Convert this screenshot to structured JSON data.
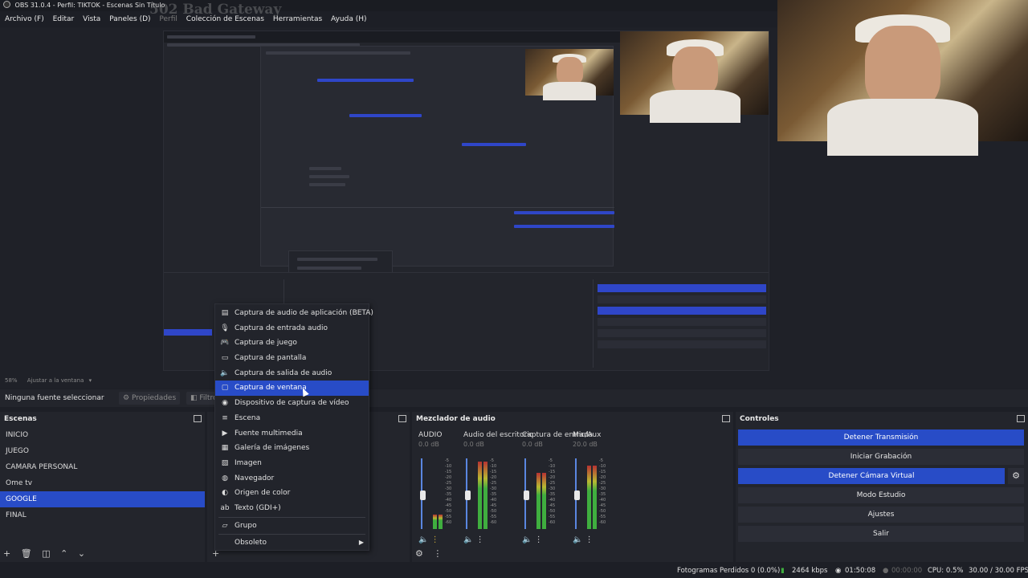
{
  "window": {
    "title": "OBS 31.0.4 - Perfil: TIKTOK - Escenas Sin Título"
  },
  "menu": [
    "Archivo (F)",
    "Editar",
    "Vista",
    "Paneles (D)",
    "Perfil",
    "Colección de Escenas",
    "Herramientas",
    "Ayuda (H)"
  ],
  "overlay_text": "502 Bad Gateway",
  "preview": {
    "zoom_label": "58%",
    "fit_label": "Ajustar a la ventana"
  },
  "sources_toolbar": {
    "no_source": "Ninguna fuente seleccionar",
    "properties": "Propiedades",
    "filters": "Filtros"
  },
  "scenes": {
    "title": "Escenas",
    "items": [
      "INICIO",
      "JUEGO",
      "CAMARA PERSONAL",
      "Ome tv",
      "GOOGLE",
      "FINAL"
    ],
    "active_index": 4
  },
  "context_menu": {
    "items": [
      {
        "label": "Captura de audio de aplicación (BETA)",
        "icon": "app-audio-icon"
      },
      {
        "label": "Captura de entrada audio",
        "icon": "microphone-icon"
      },
      {
        "label": "Captura de juego",
        "icon": "gamepad-icon"
      },
      {
        "label": "Captura de pantalla",
        "icon": "monitor-icon"
      },
      {
        "label": "Captura de salida de audio",
        "icon": "speaker-icon"
      },
      {
        "label": "Captura de ventana",
        "icon": "window-icon",
        "selected": true
      },
      {
        "label": "Dispositivo de captura de vídeo",
        "icon": "camera-icon"
      },
      {
        "label": "Escena",
        "icon": "list-icon"
      },
      {
        "label": "Fuente multimedia",
        "icon": "play-icon"
      },
      {
        "label": "Galería de imágenes",
        "icon": "images-icon"
      },
      {
        "label": "Imagen",
        "icon": "image-icon"
      },
      {
        "label": "Navegador",
        "icon": "globe-icon"
      },
      {
        "label": "Origen de color",
        "icon": "palette-icon"
      },
      {
        "label": "Texto (GDI+)",
        "icon": "text-icon"
      },
      {
        "label": "Grupo",
        "icon": "folder-icon"
      },
      {
        "label": "Obsoleto",
        "icon": ""
      }
    ]
  },
  "mixer": {
    "title": "Mezclador de audio",
    "channels": [
      {
        "name": "AUDIO",
        "db": "0.0 dB",
        "level": 0.2
      },
      {
        "name": "Audio del escritorio",
        "db": "0.0 dB",
        "level": 0.95
      },
      {
        "name": "Captura de entrada",
        "db": "0.0 dB",
        "level": 0.8
      },
      {
        "name": "Mic/Aux",
        "db": "20.0 dB",
        "level": 0.9
      }
    ],
    "scale": [
      "-5",
      "-10",
      "-15",
      "-20",
      "-25",
      "-30",
      "-35",
      "-40",
      "-45",
      "-50",
      "-55",
      "-60"
    ]
  },
  "controls": {
    "title": "Controles",
    "buttons": [
      {
        "label": "Detener Transmisión",
        "active": true
      },
      {
        "label": "Iniciar Grabación",
        "active": false
      },
      {
        "label": "Detener Cámara Virtual",
        "active": true
      },
      {
        "label": "Modo Estudio",
        "active": false
      },
      {
        "label": "Ajustes",
        "active": false
      },
      {
        "label": "Salir",
        "active": false
      }
    ]
  },
  "status": {
    "dropped_frames": "Fotogramas Perdidos 0 (0.0%)",
    "bitrate": "2464 kbps",
    "stream_time": "01:50:08",
    "rec_time": "00:00:00",
    "cpu": "CPU: 0.5%",
    "fps": "30.00 / 30.00 FPS"
  },
  "colors": {
    "accent": "#284cc7",
    "bg": "#1d1f26",
    "panel": "#23252c"
  }
}
